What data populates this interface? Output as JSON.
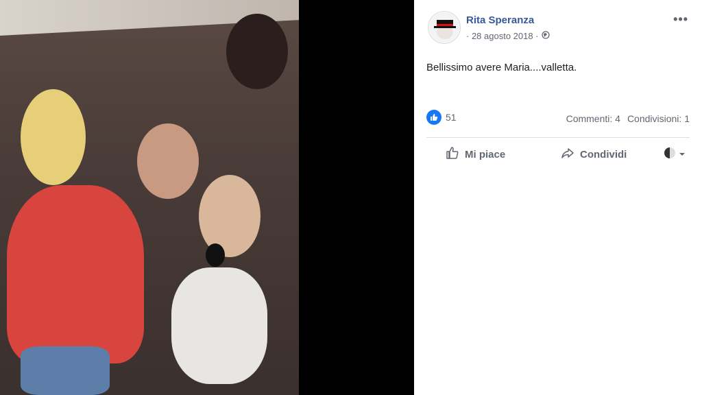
{
  "post": {
    "author": "Rita Speranza",
    "date": "· 28 agosto 2018 ·",
    "privacy_icon": "globe-icon",
    "text": "Bellissimo avere Maria....valletta.",
    "more_label": "•••"
  },
  "reactions": {
    "like_count": "51",
    "comments": "Commenti: 4",
    "shares": "Condivisioni: 1"
  },
  "actions": {
    "like_label": "Mi piace",
    "share_label": "Condividi"
  },
  "colors": {
    "author_link": "#385898",
    "like_blue": "#1877f2",
    "muted_text": "#606770"
  }
}
